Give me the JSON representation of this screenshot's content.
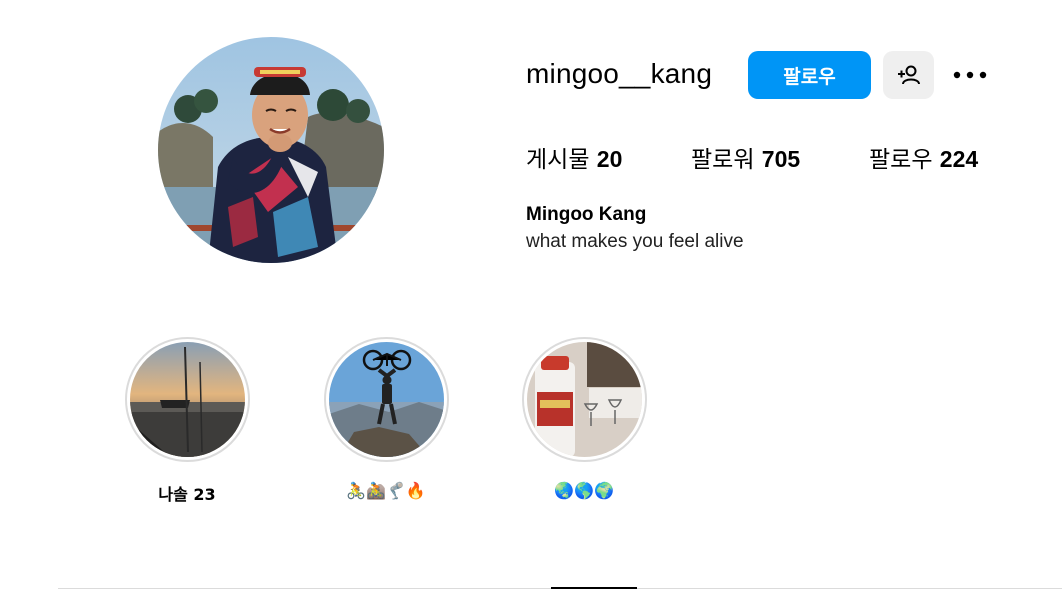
{
  "profile": {
    "username": "mingoo__kang",
    "full_name": "Mingoo Kang",
    "bio": "what makes you feel alive",
    "avatar_icon": "profile-photo-cyclist"
  },
  "actions": {
    "follow_label": "팔로우",
    "suggest_icon": "add-person-icon",
    "more_icon": "more-options-icon",
    "accent": "#0095f6"
  },
  "stats": {
    "posts_label": "게시물",
    "posts_count": "20",
    "followers_label": "팔로워",
    "followers_count": "705",
    "following_label": "팔로우",
    "following_count": "224"
  },
  "highlights": [
    {
      "label": "나솔 23",
      "cover": "fishing-boat-sunset"
    },
    {
      "label": "🚴🚵🦿🔥",
      "cover": "cyclist-holding-bike"
    },
    {
      "label": "🌏🌎🌍",
      "cover": "liquor-bottle-and-glasses"
    }
  ]
}
